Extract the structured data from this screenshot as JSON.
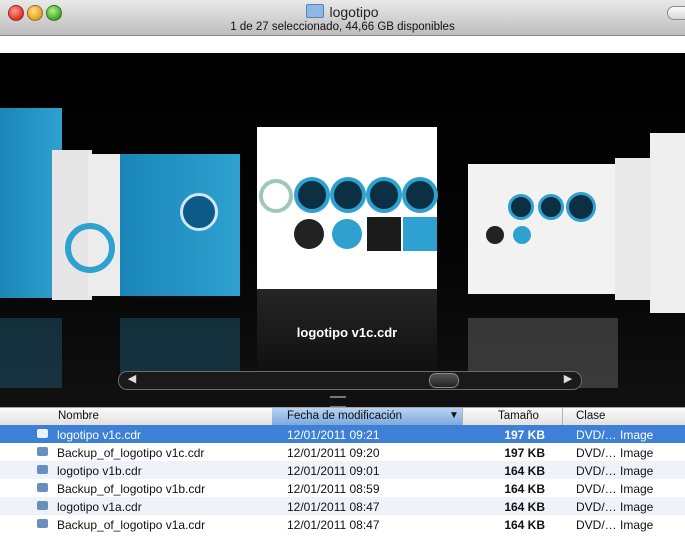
{
  "window": {
    "title": "logotipo",
    "status": "1 de 27 seleccionado, 44,66 GB disponibles"
  },
  "coverflow": {
    "caption": "logotipo v1c.cdr"
  },
  "colors": {
    "accent": "#3d80d6",
    "brand_blue": "#1a86b8"
  },
  "columns": {
    "name": "Nombre",
    "date": "Fecha de modificación",
    "size": "Tamaño",
    "kind": "Clase"
  },
  "files": [
    {
      "name": "logotipo v1c.cdr",
      "date": "12/01/2011 09:21",
      "size": "197 KB",
      "kind": "DVD/… Image",
      "selected": true
    },
    {
      "name": "Backup_of_logotipo v1c.cdr",
      "date": "12/01/2011 09:20",
      "size": "197 KB",
      "kind": "DVD/… Image"
    },
    {
      "name": "logotipo v1b.cdr",
      "date": "12/01/2011 09:01",
      "size": "164 KB",
      "kind": "DVD/… Image"
    },
    {
      "name": "Backup_of_logotipo v1b.cdr",
      "date": "12/01/2011 08:59",
      "size": "164 KB",
      "kind": "DVD/… Image"
    },
    {
      "name": "logotipo v1a.cdr",
      "date": "12/01/2011 08:47",
      "size": "164 KB",
      "kind": "DVD/… Image"
    },
    {
      "name": "Backup_of_logotipo v1a.cdr",
      "date": "12/01/2011 08:47",
      "size": "164 KB",
      "kind": "DVD/… Image"
    }
  ]
}
